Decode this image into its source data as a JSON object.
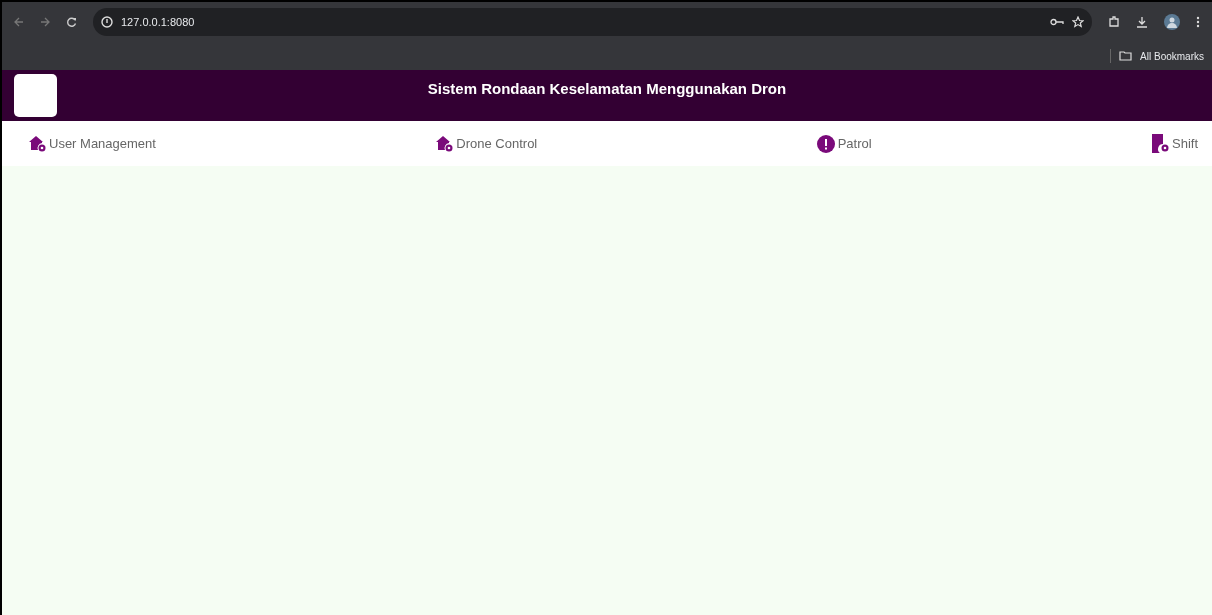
{
  "browser": {
    "url": "127.0.0.1:8080",
    "bookmarks": "All Bookmarks"
  },
  "header": {
    "title": "Sistem Rondaan Keselamatan Menggunakan Dron"
  },
  "nav": [
    {
      "label": "User Management",
      "kind": "house"
    },
    {
      "label": "Drone Control",
      "kind": "house"
    },
    {
      "label": "Patrol",
      "kind": "alert"
    },
    {
      "label": "Shift",
      "kind": "building"
    }
  ]
}
